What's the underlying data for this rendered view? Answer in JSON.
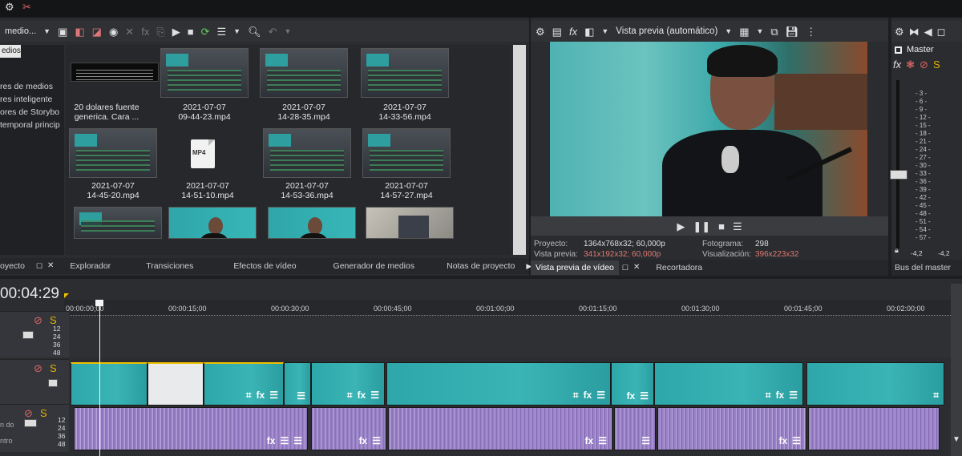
{
  "top_menu": {
    "icons": [
      "gear-icon",
      "cut-icon"
    ]
  },
  "media_toolbar": {
    "dropdown_label": "medio...",
    "icons": [
      "import-icon",
      "capture-icon",
      "web-icon",
      "remove-icon",
      "effects-icon",
      "play-icon",
      "stop-icon",
      "refresh-icon",
      "view-icon",
      "zoom-icon",
      "undo-icon"
    ]
  },
  "media_tree": {
    "selected": "edios",
    "items": [
      "res de medios",
      "res inteligente",
      "ores de Storybo",
      "temporal princip"
    ]
  },
  "media_grid": [
    {
      "caption_l1": "20 dolares fuente",
      "caption_l2": "generica. Cara ...",
      "kind": "text"
    },
    {
      "caption_l1": "2021-07-07",
      "caption_l2": "09-44-23.mp4",
      "kind": "screen"
    },
    {
      "caption_l1": "2021-07-07",
      "caption_l2": "14-28-35.mp4",
      "kind": "screen"
    },
    {
      "caption_l1": "2021-07-07",
      "caption_l2": "14-33-56.mp4",
      "kind": "screen"
    },
    {
      "caption_l1": "2021-07-07",
      "caption_l2": "14-45-20.mp4",
      "kind": "screen"
    },
    {
      "caption_l1": "2021-07-07",
      "caption_l2": "14-51-10.mp4",
      "kind": "file"
    },
    {
      "caption_l1": "2021-07-07",
      "caption_l2": "14-53-36.mp4",
      "kind": "screen"
    },
    {
      "caption_l1": "2021-07-07",
      "caption_l2": "14-57-27.mp4",
      "kind": "screen"
    }
  ],
  "file_icon_label": "MP4",
  "left_tabs": [
    "oyecto",
    "Explorador",
    "Transiciones",
    "Efectos de vídeo",
    "Generador de medios",
    "Notas de proyecto"
  ],
  "preview": {
    "toolbar_label": "Vista previa (automático)",
    "info": {
      "proyecto_label": "Proyecto:",
      "proyecto_value": "1364x768x32; 60,000p",
      "vista_label": "Vista previa:",
      "vista_value": "341x192x32; 60,000p",
      "fotograma_label": "Fotograma:",
      "fotograma_value": "298",
      "visualizacion_label": "Visualización:",
      "visualizacion_value": "396x223x32"
    },
    "tabs": [
      "Vista previa de vídeo",
      "Recortadora"
    ]
  },
  "master": {
    "title": "Master",
    "scale": [
      "3",
      "6",
      "9",
      "12",
      "15",
      "18",
      "21",
      "24",
      "27",
      "30",
      "33",
      "36",
      "39",
      "42",
      "45",
      "48",
      "51",
      "54",
      "57"
    ],
    "bottom_left": "-4,2",
    "bottom_right": "-4,2",
    "tab": "Bus del master"
  },
  "timeline": {
    "timecode": "00:04:29",
    "ruler": [
      "00:00:00;00",
      "00:00:15;00",
      "00:00:30;00",
      "00:00:45;00",
      "00:01:00;00",
      "00:01:15;00",
      "00:01:30;00",
      "00:01:45;00",
      "00:02:00;00"
    ],
    "track_scale": [
      "12",
      "24",
      "36",
      "48"
    ],
    "audio_label_1": "n do",
    "audio_label_2": "ntro"
  },
  "colors": {
    "accent_yellow": "#f0c000",
    "preview_red": "#e07a72",
    "video_clip": "#2ea7aa",
    "audio_clip": "#a48ed0"
  }
}
